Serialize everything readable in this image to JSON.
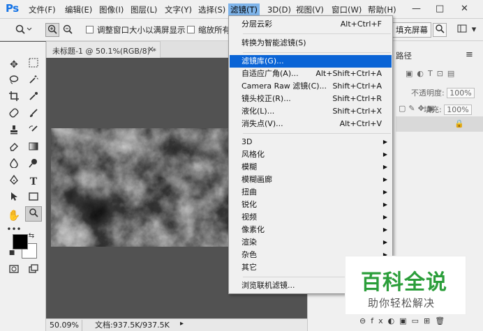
{
  "app": {
    "logo": "Ps"
  },
  "menubar": {
    "items": [
      "文件(F)",
      "编辑(E)",
      "图像(I)",
      "图层(L)",
      "文字(Y)",
      "选择(S)",
      "滤镜(T)",
      "3D(D)",
      "视图(V)",
      "窗口(W)",
      "帮助(H)"
    ],
    "active": "滤镜(T)",
    "window_buttons": [
      "—",
      "□",
      "✕"
    ]
  },
  "options_bar": {
    "tool_icon": "zoom-tool-icon",
    "resize_window_label": "调整窗口大小以满屏显示",
    "zoom_all_label": "缩放所有",
    "fill_screen_label": "填充屏幕"
  },
  "document": {
    "tab_title": "未标题-1 @ 50.1%(RGB/8) *",
    "close_symbol": "✕"
  },
  "status_bar": {
    "zoom": "50.09%",
    "doc_info": "文档:937.5K/937.5K"
  },
  "right_panel": {
    "tab_paths": "路径",
    "opacity_label": "不透明度:",
    "opacity_value": "100%",
    "fill_label": "填充:",
    "fill_value": "100%"
  },
  "filter_menu": {
    "items": [
      {
        "label": "分层云彩",
        "shortcut": "Alt+Ctrl+F"
      },
      {
        "label": "转换为智能滤镜(S)",
        "shortcut": ""
      },
      {
        "label": "滤镜库(G)...",
        "shortcut": "",
        "highlighted": true
      },
      {
        "label": "自适应广角(A)...",
        "shortcut": "Alt+Shift+Ctrl+A"
      },
      {
        "label": "Camera Raw 滤镜(C)...",
        "shortcut": "Shift+Ctrl+A"
      },
      {
        "label": "镜头校正(R)...",
        "shortcut": "Shift+Ctrl+R"
      },
      {
        "label": "液化(L)...",
        "shortcut": "Shift+Ctrl+X"
      },
      {
        "label": "消失点(V)...",
        "shortcut": "Alt+Ctrl+V"
      },
      {
        "label": "3D",
        "submenu": true
      },
      {
        "label": "风格化",
        "submenu": true
      },
      {
        "label": "模糊",
        "submenu": true
      },
      {
        "label": "模糊画廊",
        "submenu": true
      },
      {
        "label": "扭曲",
        "submenu": true
      },
      {
        "label": "锐化",
        "submenu": true
      },
      {
        "label": "视频",
        "submenu": true
      },
      {
        "label": "像素化",
        "submenu": true
      },
      {
        "label": "渲染",
        "submenu": true
      },
      {
        "label": "杂色",
        "submenu": true
      },
      {
        "label": "其它",
        "submenu": true
      },
      {
        "label": "浏览联机滤镜...",
        "shortcut": ""
      }
    ]
  },
  "watermark": {
    "title": "百科全说",
    "subtitle": "助你轻松解决",
    "color": "#2b9e3a"
  },
  "colors": {
    "menu_highlight": "#0a64d6",
    "active_menu": "#7eb4ea",
    "ps_blue": "#1473e6"
  }
}
